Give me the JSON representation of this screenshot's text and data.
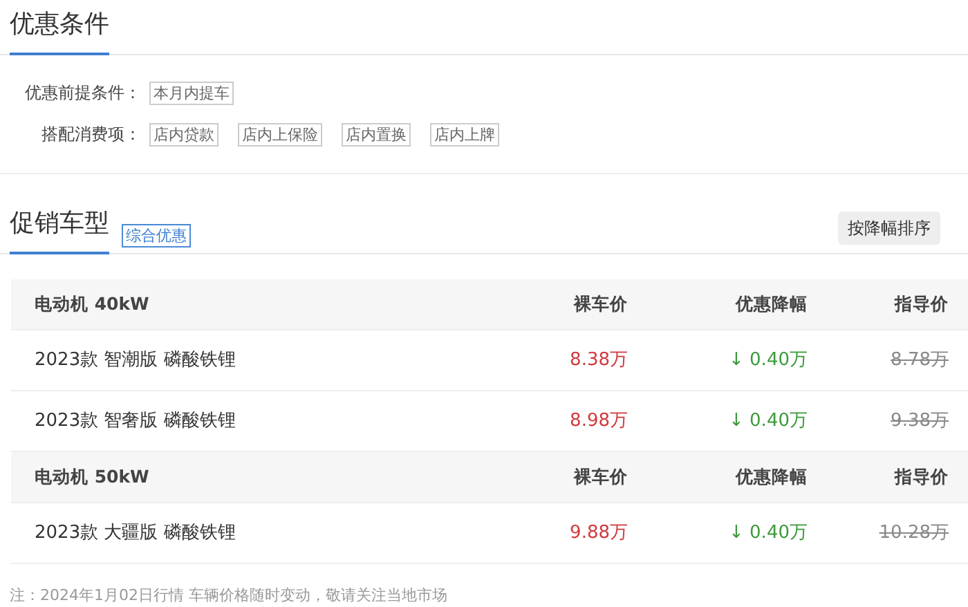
{
  "conditions_section": {
    "title": "优惠条件",
    "conditions": [
      {
        "label": "优惠前提条件：",
        "tags": [
          "本月内提车"
        ]
      },
      {
        "label": "搭配消费项：",
        "tags": [
          "店内贷款",
          "店内上保险",
          "店内置换",
          "店内上牌"
        ]
      }
    ]
  },
  "models_section": {
    "title": "促销车型",
    "tag": "综合优惠",
    "sort_button": "按降幅排序",
    "groups": [
      {
        "name": "电动机 40kW",
        "columns": [
          "裸车价",
          "优惠降幅",
          "指导价"
        ],
        "rows": [
          {
            "name": "2023款 智潮版 磷酸铁锂",
            "price": "8.38万",
            "discount": "↓ 0.40万",
            "guide_price": "8.78万"
          },
          {
            "name": "2023款 智奢版 磷酸铁锂",
            "price": "8.98万",
            "discount": "↓ 0.40万",
            "guide_price": "9.38万"
          }
        ]
      },
      {
        "name": "电动机 50kW",
        "columns": [
          "裸车价",
          "优惠降幅",
          "指导价"
        ],
        "rows": [
          {
            "name": "2023款 大疆版 磷酸铁锂",
            "price": "9.88万",
            "discount": "↓ 0.40万",
            "guide_price": "10.28万"
          }
        ]
      }
    ]
  },
  "note": "注：2024年1月02日行情 车辆价格随时变动，敬请关注当地市场"
}
